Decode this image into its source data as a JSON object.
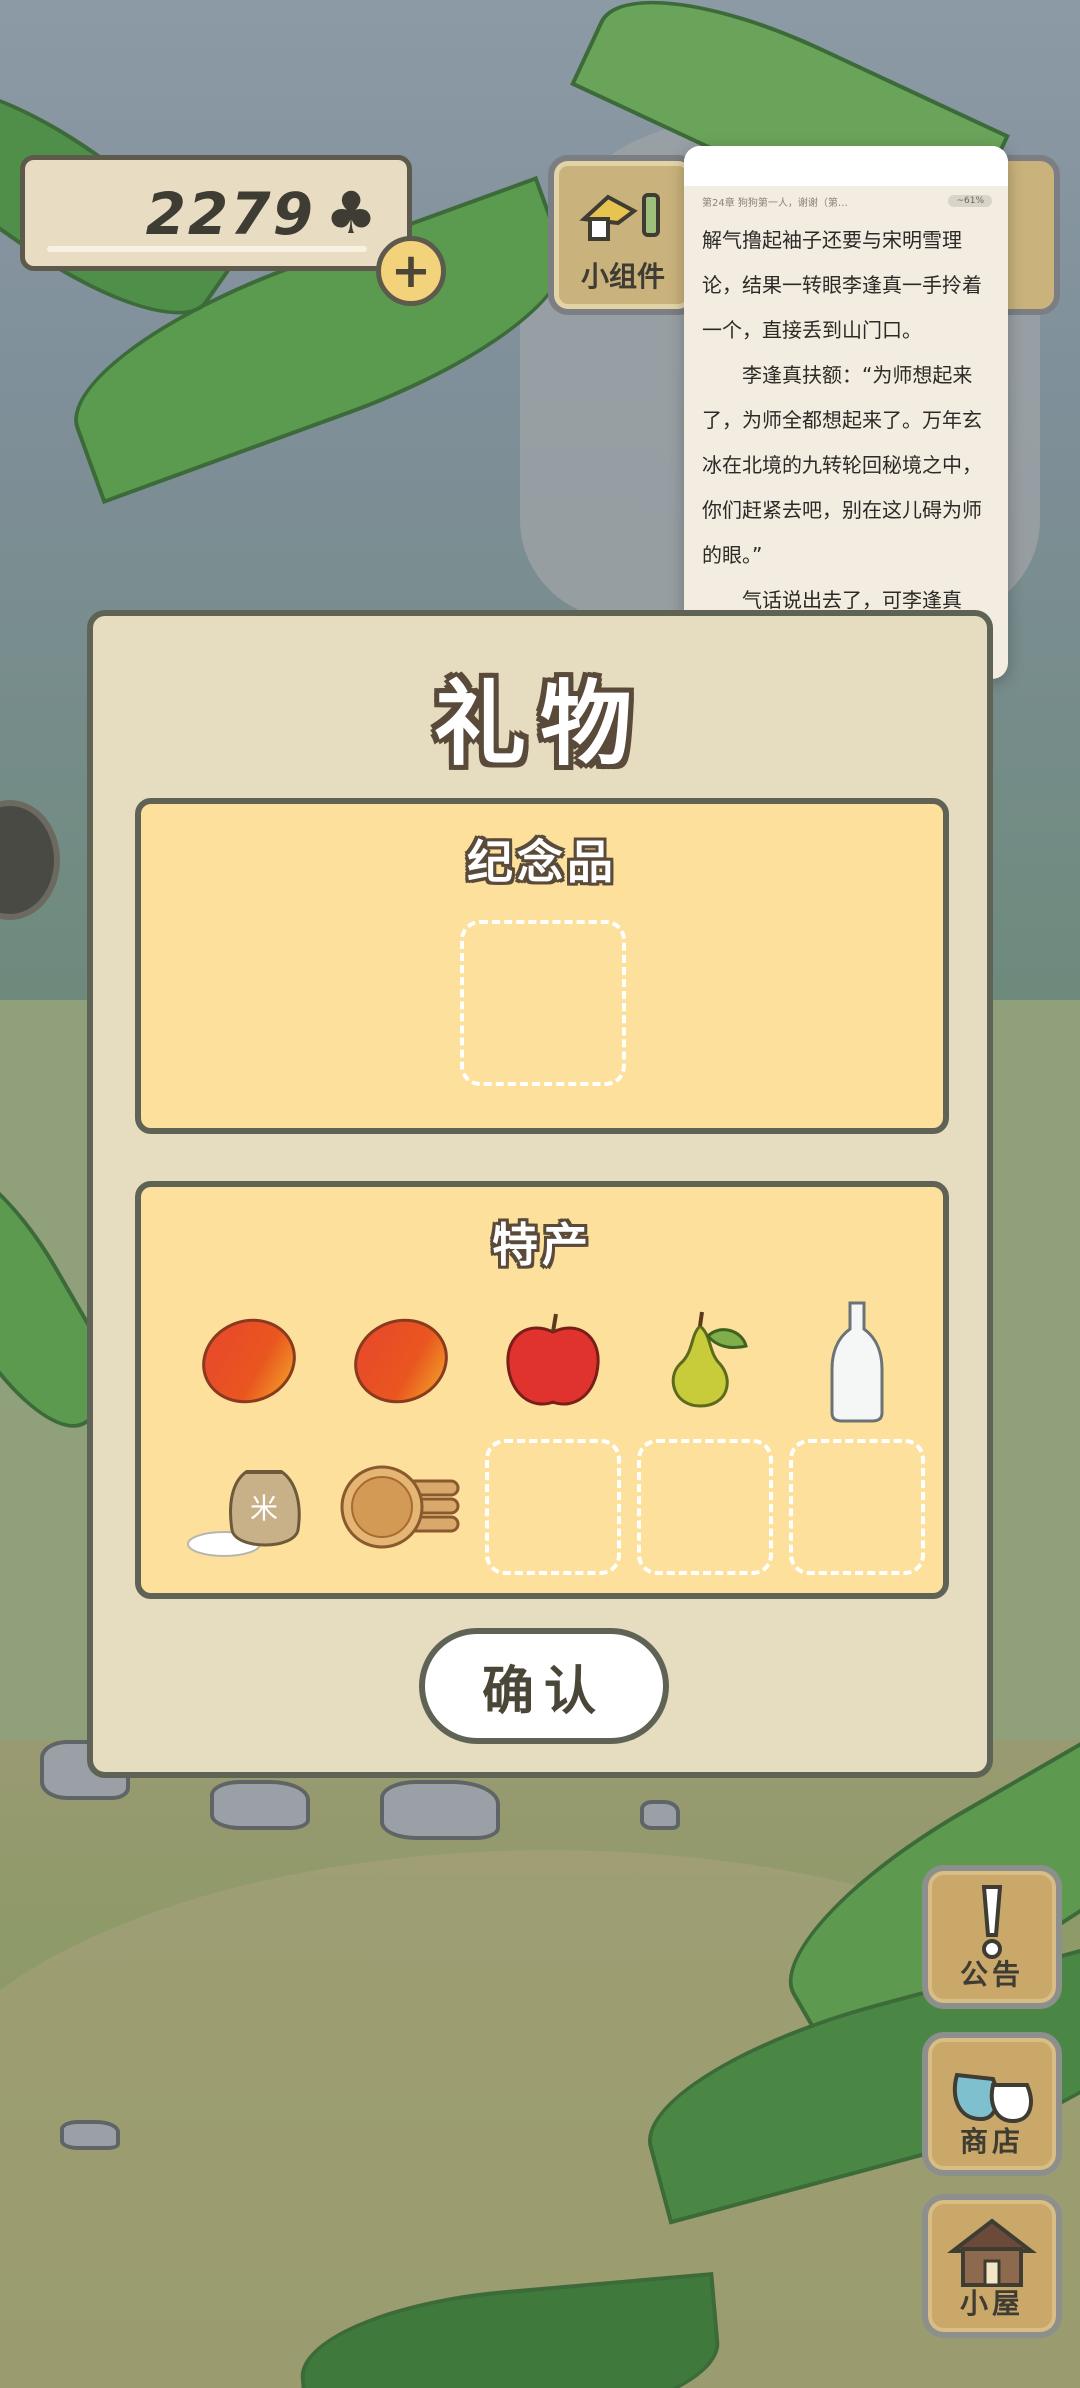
{
  "hud": {
    "clover_count": "2279",
    "clover_symbol": "♣",
    "plus_symbol": "+",
    "widget_label": "小组件"
  },
  "reader": {
    "chapter_line": "第24章 狗狗第一人，谢谢（第…",
    "battery_chip": "~61%",
    "paragraphs": [
      "解气撸起袖子还要与宋明雪理论，结果一转眼李逢真一手拎着一个，直接丢到山门口。",
      "李逢真扶额：“为师想起来了，为师全都想起来了。万年玄冰在北境的九转轮回秘境之中，你们赶紧去吧，别在这儿碍为师的眼。”",
      "气话说出去了，可李逢真"
    ]
  },
  "dialog": {
    "title": "礼物",
    "souvenir_title": "纪念品",
    "specialty_title": "特产",
    "confirm_label": "确认",
    "specialty_items": [
      {
        "name": "mango",
        "icon": "mango-icon"
      },
      {
        "name": "mango",
        "icon": "mango-icon"
      },
      {
        "name": "apple",
        "icon": "apple-icon"
      },
      {
        "name": "pear",
        "icon": "pear-icon"
      },
      {
        "name": "bottle",
        "icon": "bottle-icon"
      },
      {
        "name": "rice sack",
        "icon": "rice-sack-icon",
        "text": "米"
      },
      {
        "name": "rice crackers",
        "icon": "cracker-icon"
      }
    ],
    "empty_specialty_slots": 3
  },
  "side_nav": {
    "notice_label": "公告",
    "shop_label": "商店",
    "house_label": "小屋"
  },
  "colors": {
    "panel_bg": "#e6dcc0",
    "section_bg": "#fde09b",
    "outline": "#5f6356",
    "button_wood": "#c9a86a"
  }
}
